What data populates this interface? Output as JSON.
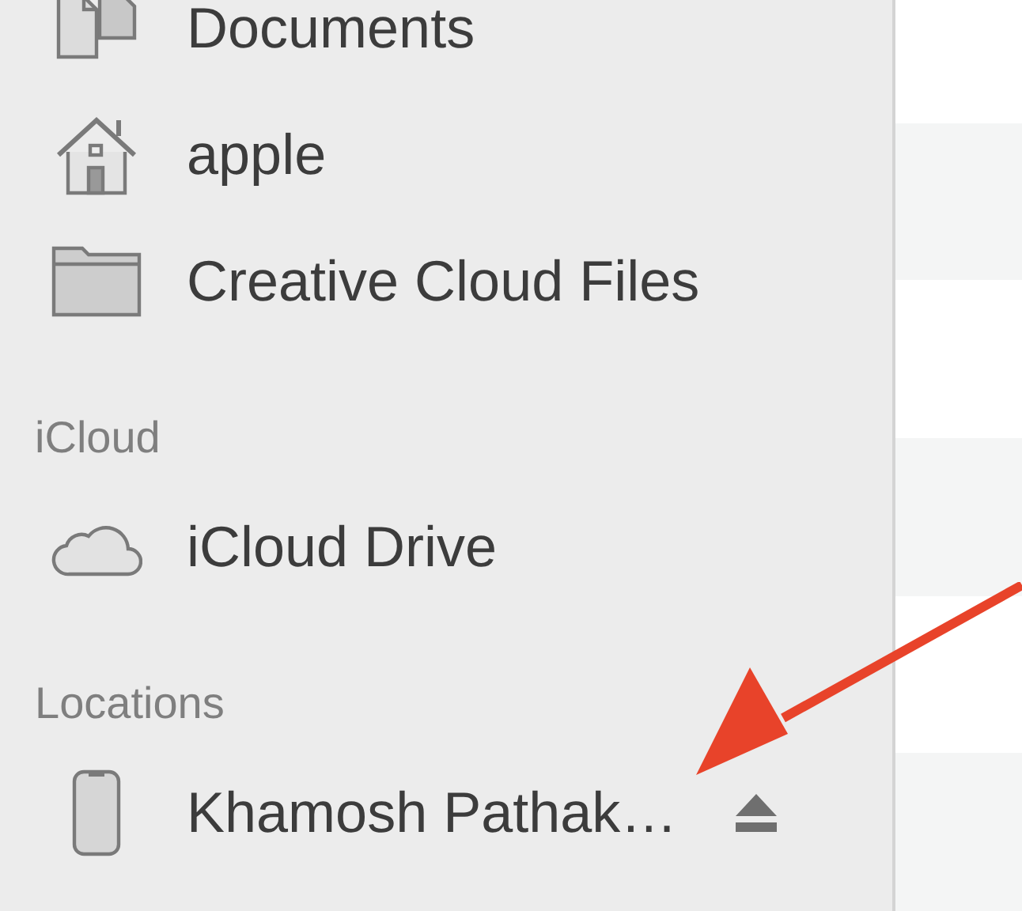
{
  "sidebar": {
    "sections": [
      {
        "items": [
          {
            "label": "Documents",
            "kind": "documents"
          },
          {
            "label": "apple",
            "kind": "home"
          },
          {
            "label": "Creative Cloud Files",
            "kind": "folder"
          }
        ]
      },
      {
        "header": "iCloud",
        "items": [
          {
            "label": "iCloud Drive",
            "kind": "cloud"
          }
        ]
      },
      {
        "header": "Locations",
        "items": [
          {
            "label": "Khamosh Pathak…",
            "kind": "phone",
            "ejectable": true
          }
        ]
      }
    ]
  }
}
